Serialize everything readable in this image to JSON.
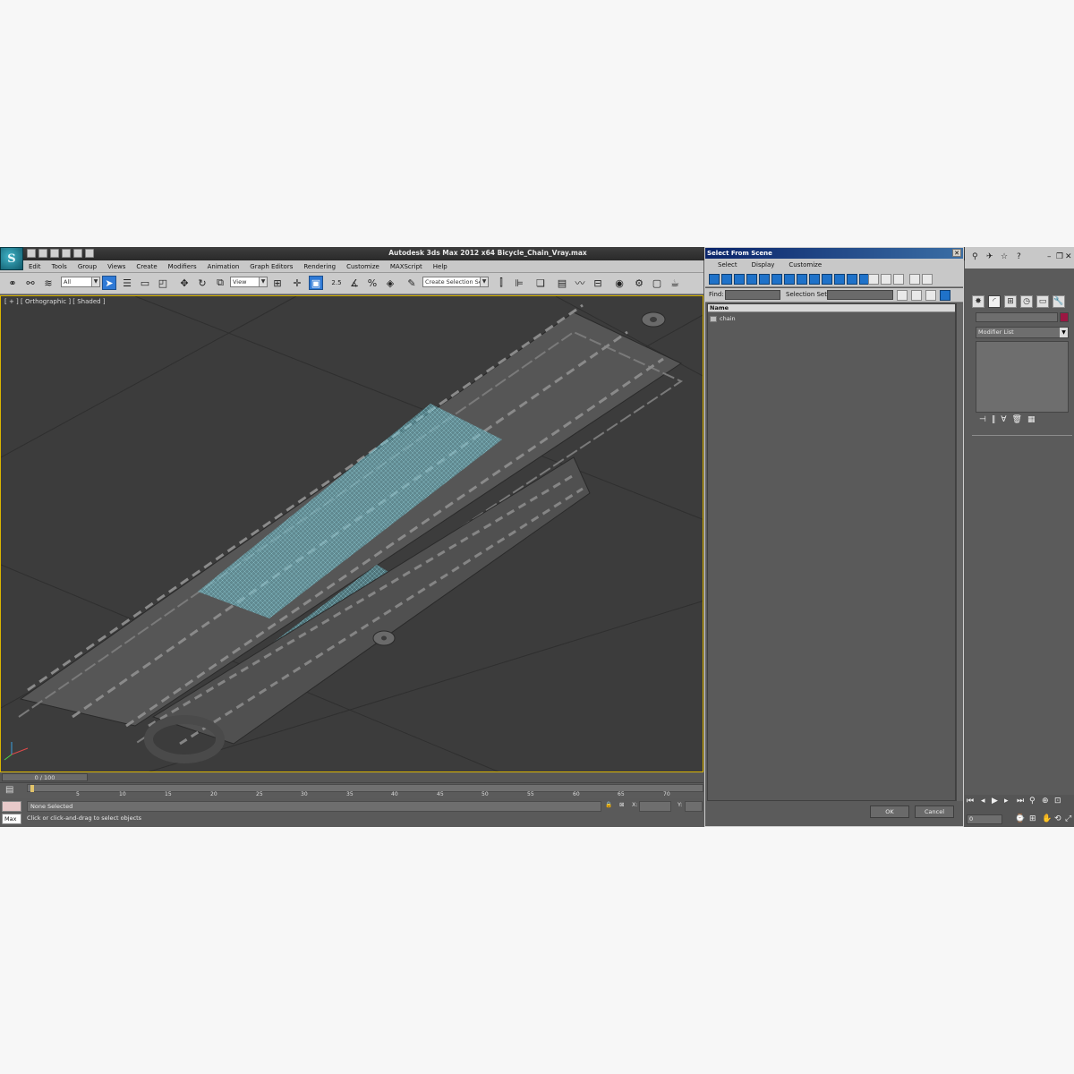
{
  "app": {
    "title": "Autodesk 3ds Max  2012 x64     Bicycle_Chain_Vray.max",
    "logo": "3ds Max logo"
  },
  "menubar": {
    "items": [
      "Edit",
      "Tools",
      "Group",
      "Views",
      "Create",
      "Modifiers",
      "Animation",
      "Graph Editors",
      "Rendering",
      "Customize",
      "MAXScript",
      "Help"
    ]
  },
  "toolbar": {
    "selection_filter": "All",
    "ref_coord": "View",
    "snap_label": "2.5",
    "named_selection": "Create Selection Se"
  },
  "viewport": {
    "label": "[ + ] [ Orthographic ] [ Shaded ]"
  },
  "timeline": {
    "slider_label": "0 / 100",
    "ticks": [
      "5",
      "10",
      "15",
      "20",
      "25",
      "30",
      "35",
      "40",
      "45",
      "50",
      "55",
      "60",
      "65",
      "70"
    ]
  },
  "status": {
    "max_label": "Max",
    "selection": "None Selected",
    "prompt": "Click or click-and-drag to select objects",
    "x_label": "X:",
    "y_label": "Y:"
  },
  "dialog": {
    "title": "Select From Scene",
    "menu": [
      "Select",
      "Display",
      "Customize"
    ],
    "find_label": "Find:",
    "selection_set_label": "Selection Set:",
    "list_header": "Name",
    "objects": [
      "chain"
    ],
    "ok_label": "OK",
    "cancel_label": "Cancel"
  },
  "command_panel": {
    "modifier_list": "Modifier List",
    "frame_value": "0",
    "name_color": "#9b1642"
  },
  "colors": {
    "accent": "#2f7ad6",
    "viewport_bg": "#3c3c3c",
    "selection_wire": "#6cc7d6"
  }
}
